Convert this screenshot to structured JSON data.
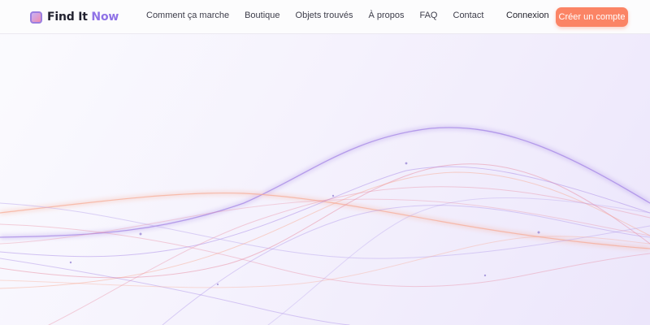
{
  "brand": {
    "name": "Find It",
    "accent": "Now",
    "icon": "logo-square-icon"
  },
  "nav": {
    "links": [
      "Comment ça marche",
      "Boutique",
      "Objets trouvés",
      "À propos",
      "FAQ",
      "Contact"
    ],
    "login_label": "Connexion",
    "signup_label": "Créer un compte"
  },
  "colors": {
    "accent": "#8f72e6",
    "button": "#fb8465",
    "wave_purple": "#9f7fe4",
    "wave_pink": "#e889a0",
    "wave_coral": "#f8a48a",
    "wave_lavender": "#bba7ee"
  }
}
